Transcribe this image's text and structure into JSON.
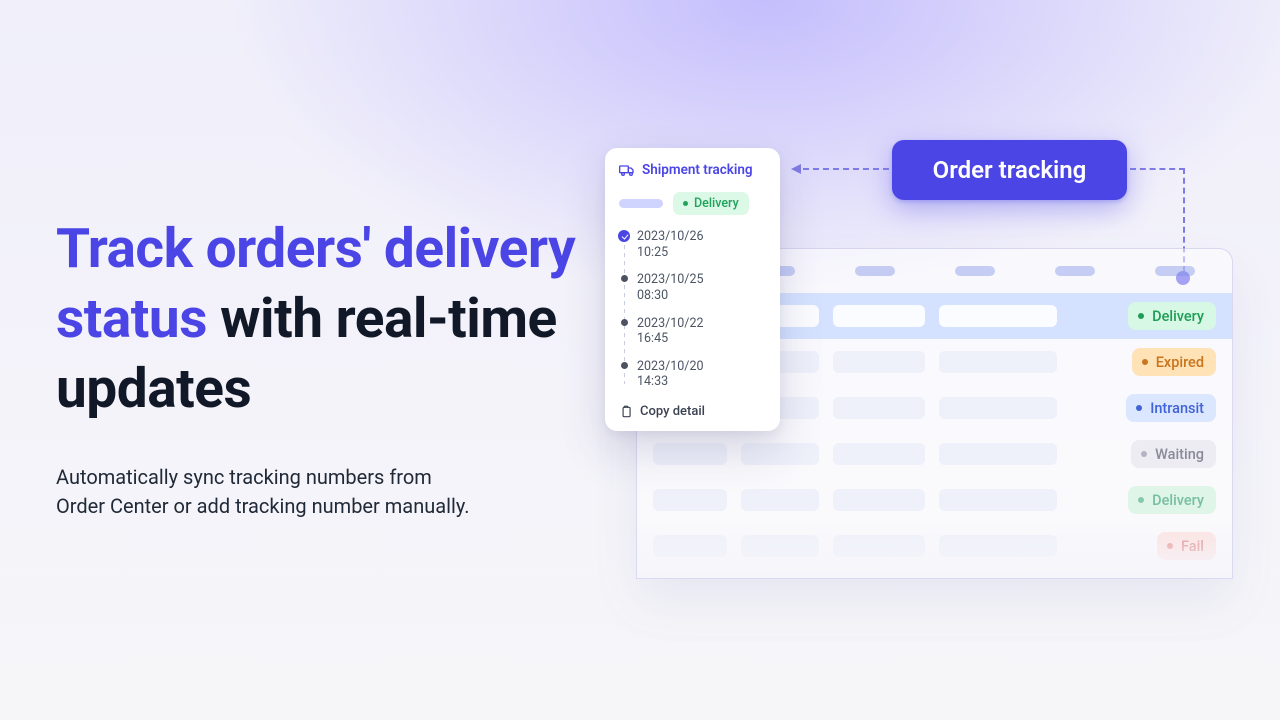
{
  "hero": {
    "headline_part1": "Track orders' delivery status",
    "headline_part2": " with real-time updates",
    "sub_line1": "Automatically sync tracking numbers from",
    "sub_line2": "Order Center or add tracking number manually."
  },
  "buttons": {
    "order_tracking": "Order tracking"
  },
  "card": {
    "title": "Shipment tracking",
    "tag": "Delivery",
    "events": [
      {
        "date": "2023/10/26",
        "time": "10:25"
      },
      {
        "date": "2023/10/25",
        "time": "08:30"
      },
      {
        "date": "2023/10/22",
        "time": "16:45"
      },
      {
        "date": "2023/10/20",
        "time": "14:33"
      }
    ],
    "copy_label": "Copy detail"
  },
  "table": {
    "rows": [
      {
        "status": "Delivery"
      },
      {
        "status": "Expired"
      },
      {
        "status": "Intransit"
      },
      {
        "status": "Waiting"
      },
      {
        "status": "Delivery"
      },
      {
        "status": "Fail"
      }
    ]
  }
}
